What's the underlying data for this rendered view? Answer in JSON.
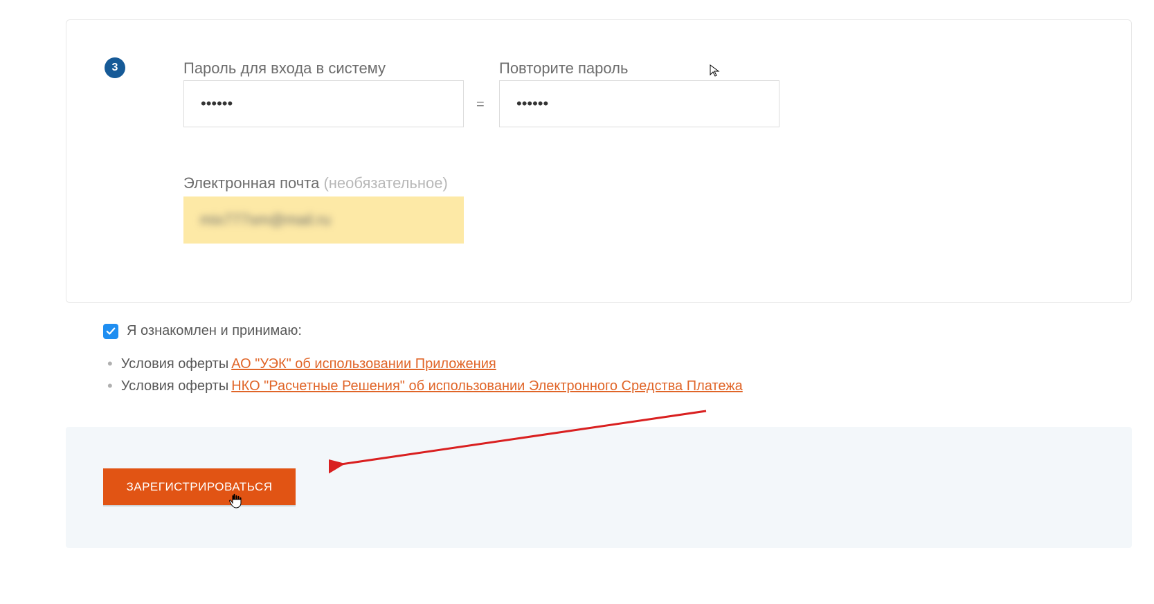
{
  "step": {
    "number": "3"
  },
  "password": {
    "label": "Пароль для входа в систему",
    "value": "••••••"
  },
  "repeat": {
    "label": "Повторите пароль",
    "value": "••••••"
  },
  "equals": "=",
  "email": {
    "label": "Электронная почта ",
    "hint": "(необязательное)",
    "value": "mix777sm@mail.ru"
  },
  "consent": {
    "label": "Я ознакомлен и принимаю:"
  },
  "terms": {
    "item1_prefix": "Условия оферты",
    "item1_link": " АО \"УЭК\" об использовании Приложения",
    "item2_prefix": "Условия оферты",
    "item2_link": " НКО \"Расчетные Решения\" об использовании Электронного Средства Платежа"
  },
  "register": {
    "label": "ЗАРЕГИСТРИРОВАТЬСЯ"
  }
}
